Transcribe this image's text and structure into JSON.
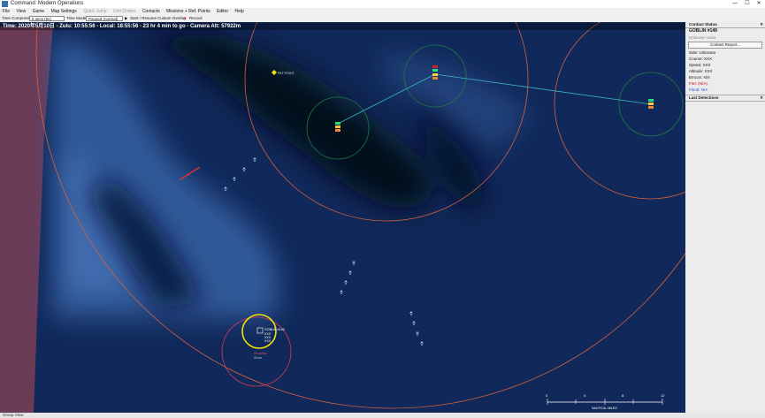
{
  "window": {
    "title": "Command: Modern Operations",
    "min": "—",
    "max": "☐",
    "close": "✕"
  },
  "menu": [
    {
      "label": "File",
      "enabled": true
    },
    {
      "label": "View",
      "enabled": true
    },
    {
      "label": "Game",
      "enabled": true
    },
    {
      "label": "Map Settings",
      "enabled": true
    },
    {
      "label": "Quick Jump",
      "enabled": false
    },
    {
      "label": "Unit Orders",
      "enabled": false
    },
    {
      "label": "Contacts",
      "enabled": true
    },
    {
      "label": "Missions + Ref. Points",
      "enabled": true
    },
    {
      "label": "Editor",
      "enabled": true
    },
    {
      "label": "Help",
      "enabled": true
    }
  ],
  "toolbar": {
    "time_compression_label": "Time Compression:",
    "time_compression_value": "5 secs (5x)",
    "time_mode_label": "Time Mode:",
    "time_mode_value": "Paused (normal)",
    "start_resume": "Start / Resume",
    "custom_overlay": "Custom Overlay",
    "record": "Record"
  },
  "status": {
    "text": "Time: 2020年5月10日 - Zulu: 10:55:56 - Local: 18:55:56 - 23 hr 4 min to go -  Camera Alt: 57922m"
  },
  "map": {
    "ref_point_label": "REF POINT",
    "selected_unit_label": "GOBLIN #149",
    "selected_unit_lines": [
      "XXX",
      "XXX",
      "XXX"
    ],
    "unit_sub_label": "5% ammo",
    "unit_sub_label2": "20 nm",
    "scale_ticks": [
      "0",
      "4",
      "8",
      "12",
      "16"
    ],
    "scale_unit": "NAUTICAL MILES"
  },
  "contact_status": {
    "header": "Contact Status",
    "close": "✕",
    "name": "GOBLIN #149",
    "subtitle": "Unknown class",
    "report_button": "Contact Report...",
    "side": "Side: Unknown",
    "course": "Course: XXX",
    "speed": "Speed: XXX",
    "altitude": "Altitude: XXX",
    "emcon": "Emcon: N/A",
    "fire": "Fire: (N/A)",
    "flood": "Flood: N/A"
  },
  "last_detections": {
    "header": "Last Detections",
    "close": "✕"
  },
  "bottom": {
    "label": "Group View"
  },
  "colors": {
    "sea": "#0d2146",
    "land": "#6b3a55",
    "range_ring": "#d9623d",
    "sensor_ring": "#1f7a45",
    "link": "#3fb5c9",
    "selection": "#f2e200",
    "unit": "#9ee4f0"
  }
}
